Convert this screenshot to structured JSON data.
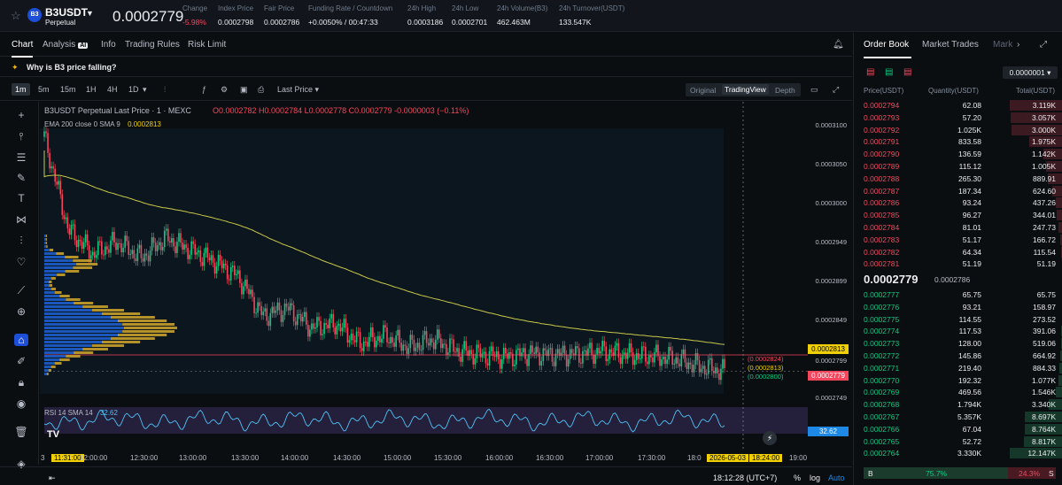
{
  "header": {
    "symbol": "B3USDT",
    "contract": "Perpetual",
    "last_price": "0.0002779",
    "stats": [
      {
        "label": "Change",
        "value": "-5.98%",
        "cls": "red"
      },
      {
        "label": "Index Price",
        "value": "0.0002798"
      },
      {
        "label": "Fair Price",
        "value": "0.0002786"
      },
      {
        "label": "Funding Rate / Countdown",
        "value": "+0.0050% / 00:47:33"
      },
      {
        "label": "24h High",
        "value": "0.0003186"
      },
      {
        "label": "24h Low",
        "value": "0.0002701"
      },
      {
        "label": "24h Volume(B3)",
        "value": "462.463M"
      },
      {
        "label": "24h Turnover(USDT)",
        "value": "133.547K"
      }
    ]
  },
  "tabs": {
    "chart": "Chart",
    "analysis": "Analysis",
    "ai_badge": "AI",
    "info": "Info",
    "trading_rules": "Trading Rules",
    "risk_limit": "Risk Limit"
  },
  "alert": "Why is B3 price falling?",
  "toolbar": {
    "intervals": [
      "1m",
      "5m",
      "15m",
      "1H",
      "4H",
      "1D"
    ],
    "selected": "1m",
    "price_type": "Last Price",
    "views": [
      "Original",
      "TradingView",
      "Depth"
    ],
    "active_view": "TradingView"
  },
  "legend": {
    "title": "B3USDT Perpetual Last Price · 1 · MEXC",
    "ohlc": "O0.0002782 H0.0002784 L0.0002778 C0.0002779 -0.0000003 (−0.11%)",
    "ema_label": "EMA 200 close 0 SMA 9",
    "ema_value": "0.0002813",
    "rsi_label": "RSI 14 SMA 14",
    "rsi_value": "32.62"
  },
  "price_axis": [
    "0.0003100",
    "0.0003050",
    "0.0003000",
    "0.0002949",
    "0.0002899",
    "0.0002849",
    "0.0002799",
    "0.0002749"
  ],
  "price_labels": {
    "ema": "0.0002813",
    "last": "0.0002779",
    "rsi": "32.62",
    "ann1": "(0.0002824)",
    "ann2": "(0.0002813)",
    "ann3": "(0.0002800)"
  },
  "time_axis": [
    "11:31:00",
    "12:00:00",
    "12:30:00",
    "13:00:00",
    "13:30:00",
    "14:00:00",
    "14:30:00",
    "15:00:00",
    "15:30:00",
    "16:00:00",
    "16:30:00",
    "17:00:00",
    "17:30:00",
    "18:0",
    "2026-05-03",
    "18:24:00",
    "19:00"
  ],
  "time_axis_first": "3",
  "bottom": {
    "clock": "18:12:28 (UTC+7)",
    "percent": "%",
    "log": "log",
    "auto": "Auto"
  },
  "orderbook": {
    "tabs": [
      "Order Book",
      "Market Trades",
      "Mark"
    ],
    "precision": "0.0000001",
    "headers": [
      "Price(USDT)",
      "Quantity(USDT)",
      "Total(USDT)"
    ],
    "asks": [
      [
        "0.0002794",
        "62.08",
        "3.119K",
        1.0
      ],
      [
        "0.0002793",
        "57.20",
        "3.057K",
        0.98
      ],
      [
        "0.0002792",
        "1.025K",
        "3.000K",
        0.96
      ],
      [
        "0.0002791",
        "833.58",
        "1.975K",
        0.63
      ],
      [
        "0.0002790",
        "136.59",
        "1.142K",
        0.37
      ],
      [
        "0.0002789",
        "115.12",
        "1.005K",
        0.32
      ],
      [
        "0.0002788",
        "265.30",
        "889.91",
        0.29
      ],
      [
        "0.0002787",
        "187.34",
        "624.60",
        0.2
      ],
      [
        "0.0002786",
        "93.24",
        "437.26",
        0.14
      ],
      [
        "0.0002785",
        "96.27",
        "344.01",
        0.11
      ],
      [
        "0.0002784",
        "81.01",
        "247.73",
        0.08
      ],
      [
        "0.0002783",
        "51.17",
        "166.72",
        0.05
      ],
      [
        "0.0002782",
        "64.34",
        "115.54",
        0.04
      ],
      [
        "0.0002781",
        "51.19",
        "51.19",
        0.02
      ]
    ],
    "mid_price": "0.0002779",
    "mid_sub": "0.0002786",
    "bids": [
      [
        "0.0002777",
        "65.75",
        "65.75",
        0.01
      ],
      [
        "0.0002776",
        "93.21",
        "158.97",
        0.01
      ],
      [
        "0.0002775",
        "114.55",
        "273.52",
        0.02
      ],
      [
        "0.0002774",
        "117.53",
        "391.06",
        0.03
      ],
      [
        "0.0002773",
        "128.00",
        "519.06",
        0.04
      ],
      [
        "0.0002772",
        "145.86",
        "664.92",
        0.05
      ],
      [
        "0.0002771",
        "219.40",
        "884.33",
        0.07
      ],
      [
        "0.0002770",
        "192.32",
        "1.077K",
        0.09
      ],
      [
        "0.0002769",
        "469.56",
        "1.546K",
        0.13
      ],
      [
        "0.0002768",
        "1.794K",
        "3.340K",
        0.27
      ],
      [
        "0.0002767",
        "5.357K",
        "8.697K",
        0.72
      ],
      [
        "0.0002766",
        "67.04",
        "8.764K",
        0.72
      ],
      [
        "0.0002765",
        "52.72",
        "8.817K",
        0.73
      ],
      [
        "0.0002764",
        "3.330K",
        "12.147K",
        1.0
      ]
    ],
    "ratio": {
      "b": "B",
      "b_pct": "75.7%",
      "s_pct": "24.3%",
      "s": "S"
    }
  },
  "colors": {
    "up": "#0ecb81",
    "down": "#f6465d",
    "ema": "#c9c94a",
    "bg": "#0b0e11"
  },
  "chart_data": {
    "type": "candlestick",
    "series_ema": "EMA 200",
    "close_samples": [
      0.000308,
      0.000296,
      0.000293,
      0.0002945,
      0.0002925,
      0.000295,
      0.0002935,
      0.000292,
      0.00029,
      0.000285,
      0.000286,
      0.0002835,
      0.000284,
      0.0002815,
      0.0002825,
      0.000281,
      0.000282,
      0.0002805,
      0.00028,
      0.0002797,
      0.0002802,
      0.00028,
      0.0002801,
      0.0002805,
      0.00028,
      0.0002798,
      0.0002795,
      0.0002785,
      0.0002779
    ]
  }
}
